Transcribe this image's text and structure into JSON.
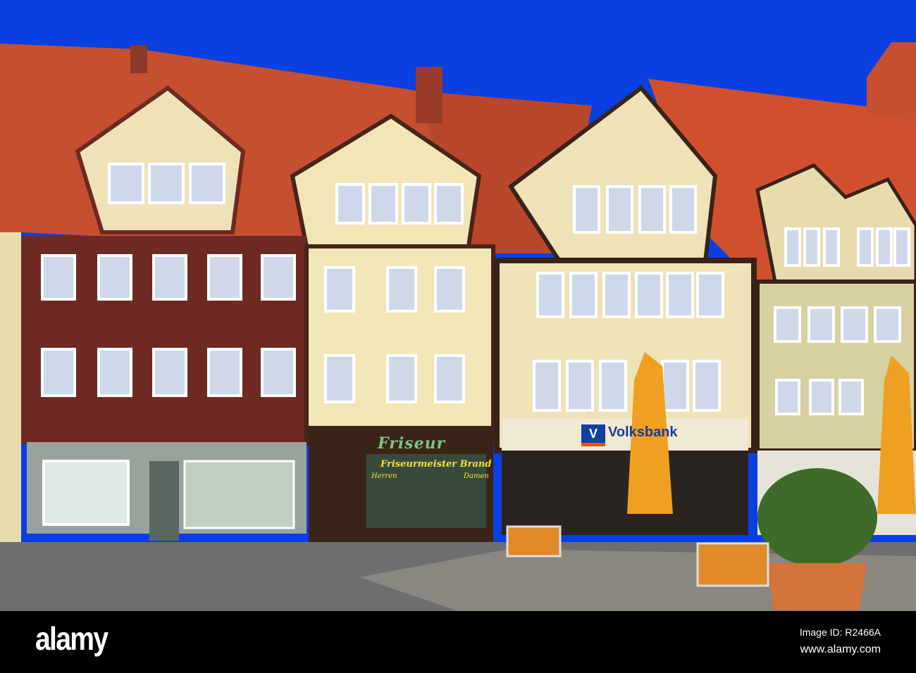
{
  "scene": {
    "description_colors": {
      "sky": "#0a3fe0",
      "roof": "#c4502f",
      "timber_dark": "#4a2418",
      "timber_red": "#6e2a22",
      "plaster": "#f2e6b8",
      "umbrella": "#f0a020"
    }
  },
  "signs": {
    "friseur": "Friseur",
    "friseurmeister": "Friseurmeister Brand",
    "herren": "Herren",
    "damen": "Damen",
    "volksbank": "Volksbank",
    "volksbank_logo": "V"
  },
  "watermark": {
    "logo": "alamy",
    "image_id": "Image ID: R2466A",
    "url": "www.alamy.com"
  }
}
